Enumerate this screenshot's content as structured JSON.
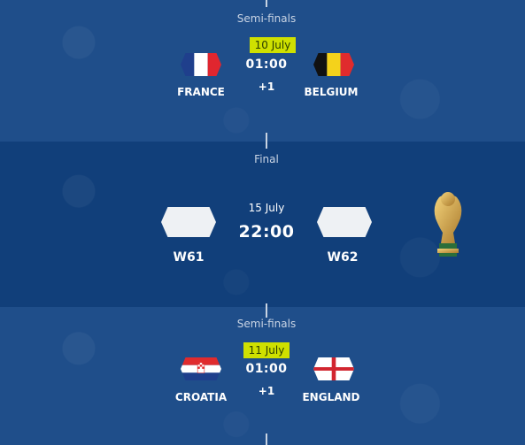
{
  "top_semifinal": {
    "stage": "Semi-finals",
    "date": "10 July",
    "time": "01:00",
    "extra": "+1",
    "home": {
      "name": "FRANCE",
      "flag_icon": "france-flag-icon"
    },
    "away": {
      "name": "BELGIUM",
      "flag_icon": "belgium-flag-icon"
    }
  },
  "final": {
    "stage": "Final",
    "date": "15 July",
    "time": "22:00",
    "home": {
      "name": "W61"
    },
    "away": {
      "name": "W62"
    },
    "trophy_icon": "world-cup-trophy-icon"
  },
  "bottom_semifinal": {
    "stage": "Semi-finals",
    "date": "11 July",
    "time": "01:00",
    "extra": "+1",
    "home": {
      "name": "CROATIA",
      "flag_icon": "croatia-flag-icon"
    },
    "away": {
      "name": "ENGLAND",
      "flag_icon": "england-flag-icon"
    }
  },
  "colors": {
    "background": "#1f4e8a",
    "final_background": "#113f7a",
    "date_highlight": "#cfe000"
  }
}
